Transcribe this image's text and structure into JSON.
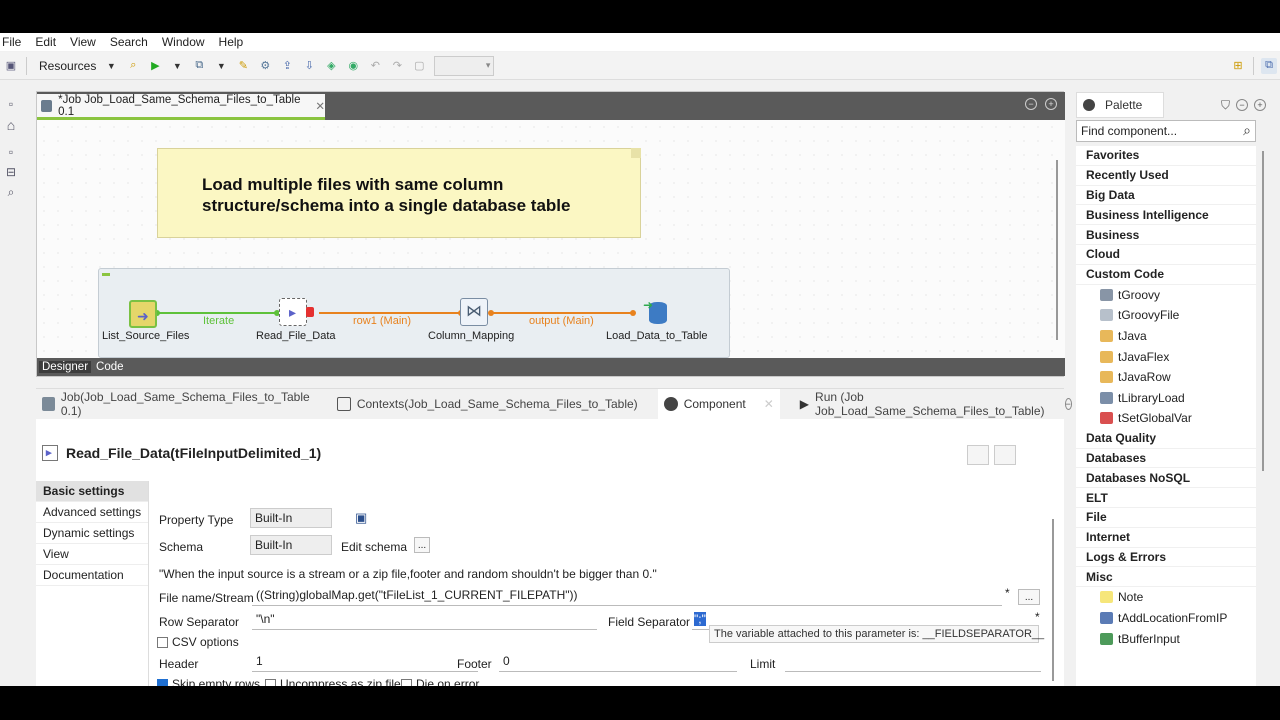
{
  "menu": [
    "File",
    "Edit",
    "View",
    "Search",
    "Window",
    "Help"
  ],
  "toolbar": {
    "perspective_label": "Resources"
  },
  "editor": {
    "tab_title": "*Job Job_Load_Same_Schema_Files_to_Table 0.1",
    "note_line1": "Load multiple files with same column",
    "note_line2": "structure/schema into a single database table",
    "components": {
      "list": "List_Source_Files",
      "read": "Read_File_Data",
      "map": "Column_Mapping",
      "load": "Load_Data_to_Table"
    },
    "links": {
      "iterate": "Iterate",
      "row1": "row1 (Main)",
      "output": "output (Main)"
    },
    "bottom_tabs": [
      "Designer",
      "Code"
    ]
  },
  "views": {
    "tabs": [
      "Job(Job_Load_Same_Schema_Files_to_Table 0.1)",
      "Contexts(Job_Load_Same_Schema_Files_to_Table)",
      "Component",
      "Run (Job Job_Load_Same_Schema_Files_to_Table)"
    ]
  },
  "component": {
    "title": "Read_File_Data(tFileInputDelimited_1)",
    "menu": [
      "Basic settings",
      "Advanced settings",
      "Dynamic settings",
      "View",
      "Documentation"
    ],
    "property_type_label": "Property Type",
    "property_type_value": "Built-In",
    "schema_label": "Schema",
    "schema_value": "Built-In",
    "edit_schema": "Edit schema",
    "warning": "\"When the input source is a stream or a zip file,footer and random shouldn't be bigger than 0.\"",
    "file_name_label": "File name/Stream",
    "file_name_value": "((String)globalMap.get(\"tFileList_1_CURRENT_FILEPATH\"))",
    "row_sep_label": "Row Separator",
    "row_sep_value": "\"\\n\"",
    "field_sep_label": "Field Separator",
    "field_sep_value": "\";\"",
    "tooltip": "The variable attached to this parameter is: __FIELDSEPARATOR__",
    "csv_options": "CSV options",
    "header_label": "Header",
    "header_value": "1",
    "footer_label": "Footer",
    "footer_value": "0",
    "limit_label": "Limit",
    "limit_value": "",
    "skip_empty": "Skip empty rows",
    "uncompress": "Uncompress as zip file",
    "die_on_error": "Die on error",
    "required_mark": "*",
    "ellipsis": "..."
  },
  "palette": {
    "tab": "Palette",
    "search_placeholder": "Find component...",
    "categories_top": [
      "Favorites",
      "Recently Used",
      "Big Data",
      "Business Intelligence",
      "Business",
      "Cloud",
      "Custom Code"
    ],
    "custom_code_items": [
      "tGroovy",
      "tGroovyFile",
      "tJava",
      "tJavaFlex",
      "tJavaRow",
      "tLibraryLoad",
      "tSetGlobalVar"
    ],
    "categories_mid": [
      "Data Quality",
      "Databases",
      "Databases NoSQL",
      "ELT",
      "File",
      "Internet",
      "Logs & Errors",
      "Misc"
    ],
    "misc_items": [
      "Note",
      "tAddLocationFromIP",
      "tBufferInput"
    ]
  }
}
